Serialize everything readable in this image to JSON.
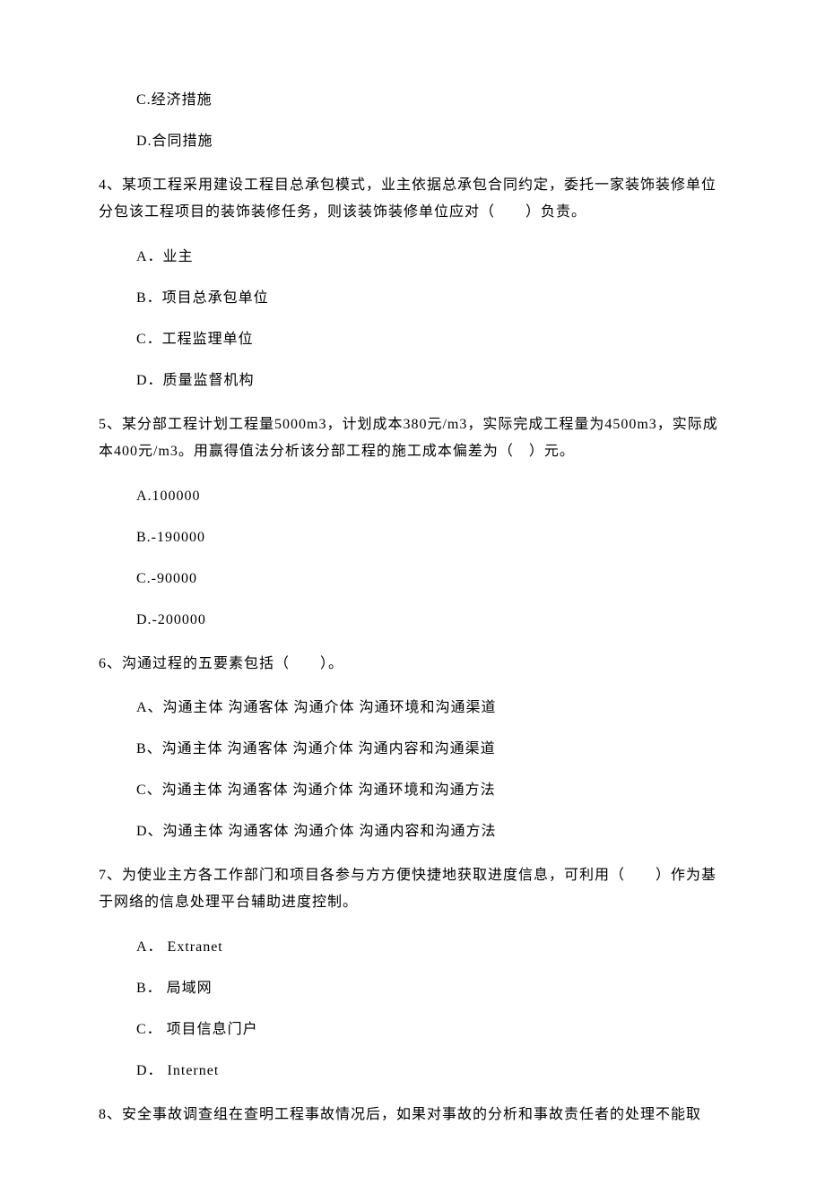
{
  "partial_top": {
    "options": [
      "C.经济措施",
      "D.合同措施"
    ]
  },
  "q4": {
    "stem": "4、某项工程采用建设工程目总承包模式，业主依据总承包合同约定，委托一家装饰装修单位分包该工程项目的装饰装修任务，则该装饰装修单位应对（　　）负责。",
    "options": [
      "A．业主",
      "B．项目总承包单位",
      "C．工程监理单位",
      "D．质量监督机构"
    ]
  },
  "q5": {
    "stem": "5、某分部工程计划工程量5000m3，计划成本380元/m3，实际完成工程量为4500m3，实际成本400元/m3。用赢得值法分析该分部工程的施工成本偏差为（　）元。",
    "options": [
      "A.100000",
      "B.-190000",
      "C.-90000",
      "D.-200000"
    ]
  },
  "q6": {
    "stem": "6、沟通过程的五要素包括（　　）。",
    "options": [
      "A、沟通主体 沟通客体 沟通介体 沟通环境和沟通渠道",
      "B、沟通主体 沟通客体 沟通介体 沟通内容和沟通渠道",
      "C、沟通主体 沟通客体 沟通介体 沟通环境和沟通方法",
      "D、沟通主体 沟通客体 沟通介体 沟通内容和沟通方法"
    ]
  },
  "q7": {
    "stem": "7、为使业主方各工作部门和项目各参与方方便快捷地获取进度信息，可利用（　　）作为基于网络的信息处理平台辅助进度控制。",
    "options": [
      "A． Extranet",
      "B． 局域网",
      "C． 项目信息门户",
      "D． Internet"
    ]
  },
  "q8": {
    "stem": "8、安全事故调查组在查明工程事故情况后，如果对事故的分析和事故责任者的处理不能取"
  }
}
